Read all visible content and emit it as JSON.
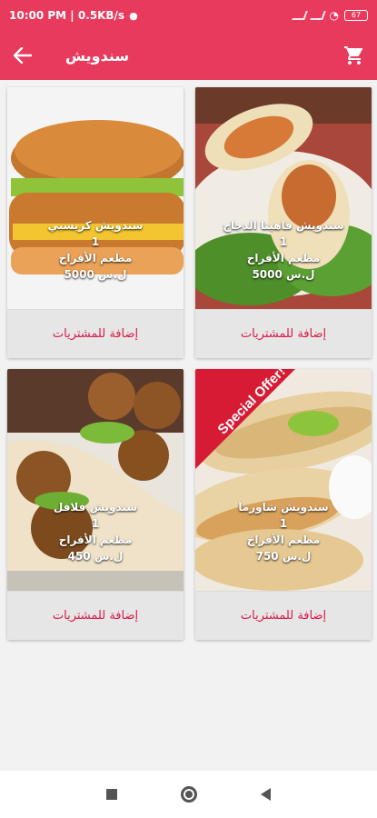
{
  "status": {
    "time_speed": "10:00 PM | 0.5KB/s",
    "battery": "67"
  },
  "appbar": {
    "title": "سندويش",
    "back_icon": "arrow-left-icon",
    "cart_icon": "cart-icon"
  },
  "colors": {
    "primary": "#e83a5c",
    "accent_text": "#d81b4a"
  },
  "products": [
    {
      "name": "سندويش كريسبي",
      "qty": "1",
      "restaurant": "مطعم الأفراح",
      "price": "5000 ل.س",
      "add_label": "إضافة للمشتريات"
    },
    {
      "name": "سندويش فاهيتا الدجاج",
      "qty": "1",
      "restaurant": "مطعم الأفراح",
      "price": "5000 ل.س",
      "add_label": "إضافة للمشتريات"
    },
    {
      "name": "سندويش فلافل",
      "qty": "1",
      "restaurant": "مطعم الأفراح",
      "price": "450 ل.س",
      "add_label": "إضافة للمشتريات"
    },
    {
      "name": "سندويش شاورما",
      "qty": "1",
      "restaurant": "مطعم الأفراح",
      "price": "750 ل.س",
      "add_label": "إضافة للمشتريات",
      "badge": "Special Offer!"
    }
  ]
}
